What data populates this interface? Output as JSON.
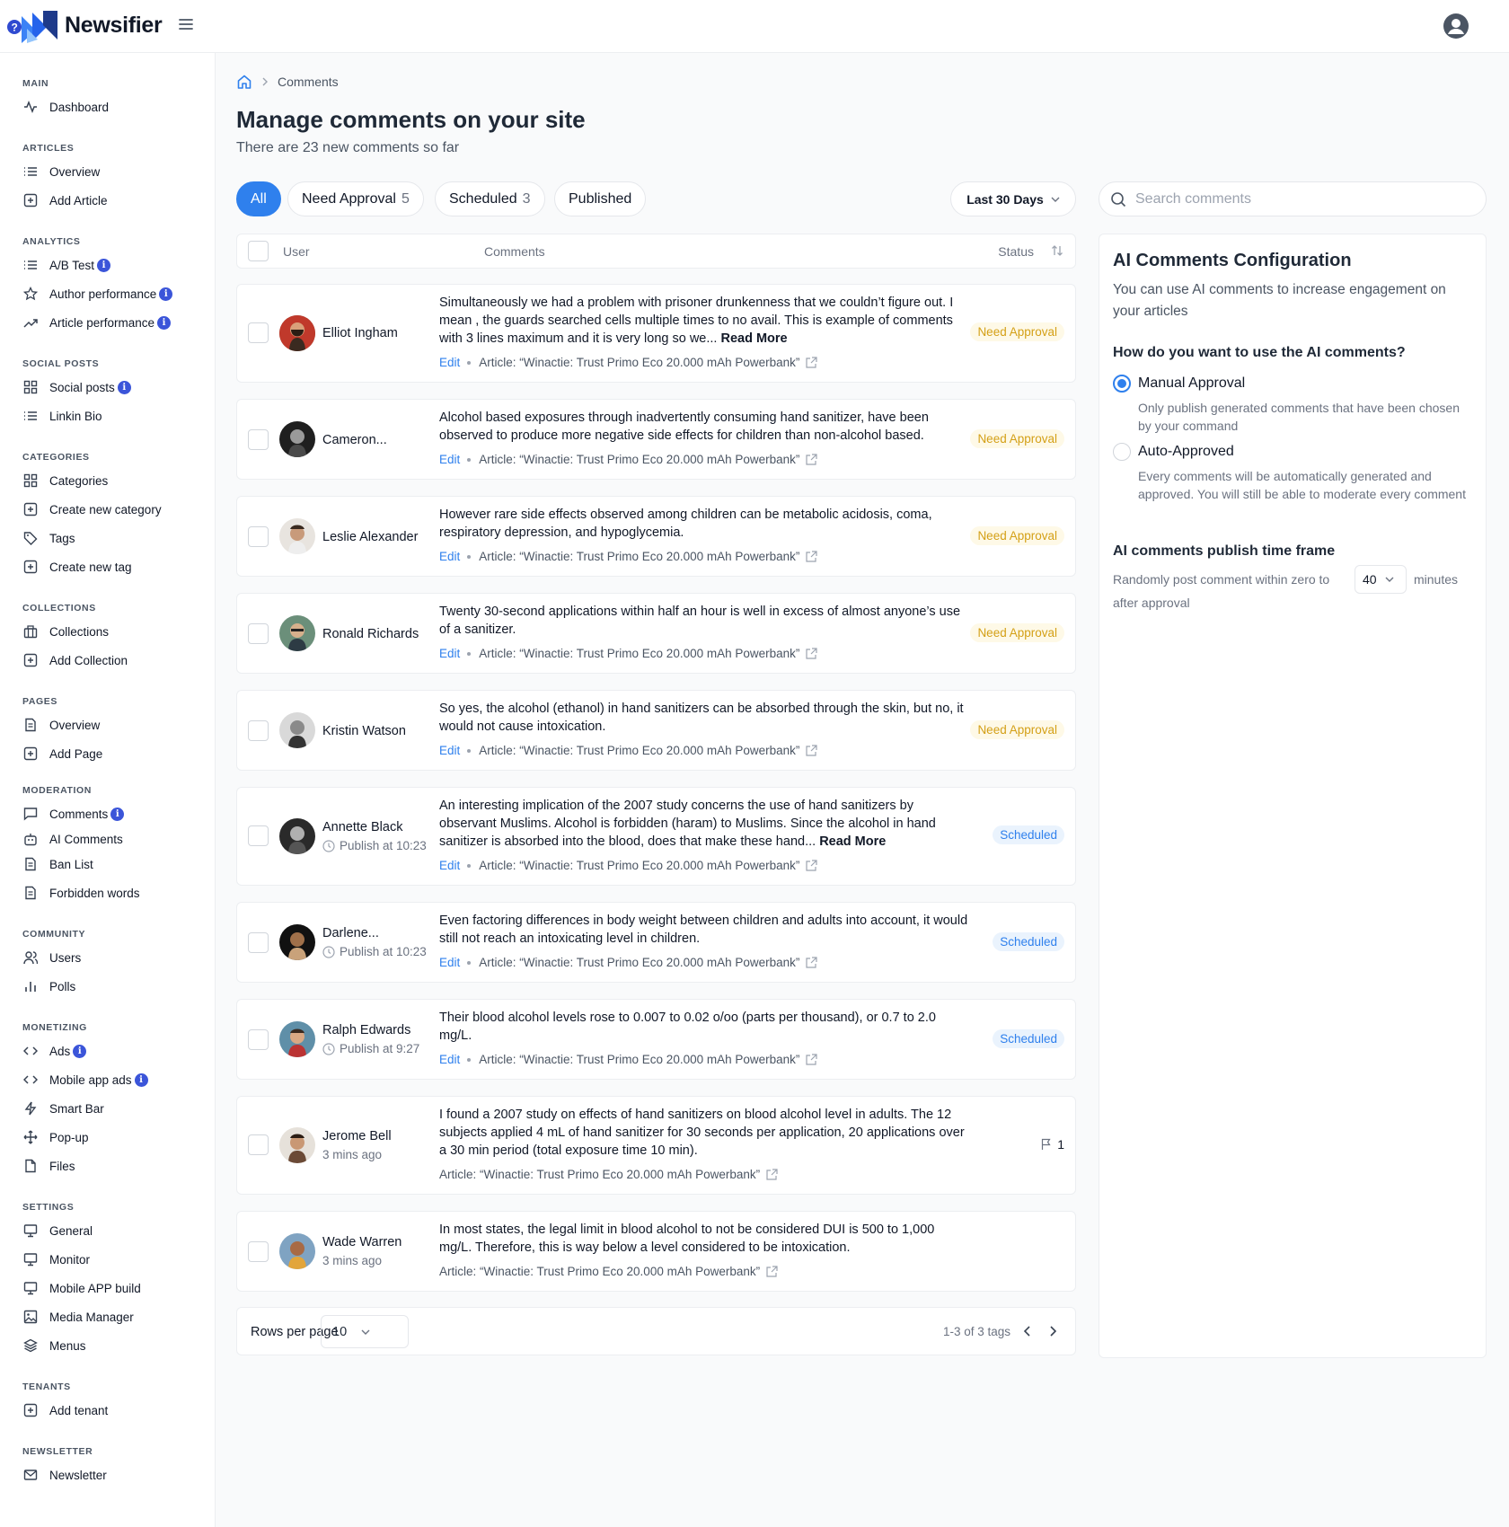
{
  "app": {
    "name": "Newsifier"
  },
  "breadcrumb": {
    "current": "Comments"
  },
  "page": {
    "title": "Manage comments on your site",
    "subtitle": "There are 23 new comments so far"
  },
  "tabs": [
    {
      "label": "All",
      "count": ""
    },
    {
      "label": "Need Approval",
      "count": "5"
    },
    {
      "label": "Scheduled",
      "count": "3"
    },
    {
      "label": "Published",
      "count": ""
    }
  ],
  "date_range": "Last 30 Days",
  "search": {
    "placeholder": "Search comments"
  },
  "table_header": {
    "user": "User",
    "comments": "Comments",
    "status": "Status"
  },
  "sidebar": {
    "main": "MAIN",
    "dashboard": "Dashboard",
    "articles": "ARTICLES",
    "overview": "Overview",
    "add_article": "Add Article",
    "analytics": "ANALYTICS",
    "ab_test": "A/B Test",
    "author_perf": "Author performance",
    "article_perf": "Article performance",
    "social": "SOCIAL POSTS",
    "social_posts": "Social posts",
    "linkin_bio": "Linkin Bio",
    "categories_h": "CATEGORIES",
    "categories": "Categories",
    "create_category": "Create new category",
    "tags": "Tags",
    "create_tag": "Create new tag",
    "collections_h": "COLLECTIONS",
    "collections": "Collections",
    "add_collection": "Add Collection",
    "pages_h": "PAGES",
    "pages_overview": "Overview",
    "add_page": "Add Page",
    "moderation_h": "MODERATION",
    "comments": "Comments",
    "ai_comments": "AI Comments",
    "ban_list": "Ban List",
    "forbidden_words": "Forbidden words",
    "community_h": "COMMUNITY",
    "users": "Users",
    "polls": "Polls",
    "monetizing_h": "MONETIZING",
    "ads": "Ads",
    "mobile_ads": "Mobile app ads",
    "smart_bar": "Smart Bar",
    "popup": "Pop-up",
    "files": "Files",
    "settings_h": "SETTINGS",
    "general": "General",
    "monitor": "Monitor",
    "mobile_build": "Mobile APP build",
    "media_manager": "Media Manager",
    "menus": "Menus",
    "tenants_h": "TENANTS",
    "add_tenant": "Add tenant",
    "newsletter_h": "NEWSLETTER",
    "newsletter": "Newsletter",
    "info_glyph": "i"
  },
  "labels": {
    "edit": "Edit",
    "read_more": "Read More",
    "article": "Article: “Winactie: Trust Primo Eco 20.000 mAh Powerbank”"
  },
  "comments": [
    {
      "user": "Elliot Ingham",
      "meta": "",
      "text": "Simultaneously we had a problem with prisoner drunkenness that we couldn’t figure out. I mean , the guards searched cells multiple times to no avail. This is example of comments with 3 lines maximum and it is very long so we...",
      "status": "Need Approval"
    },
    {
      "user": "Cameron...",
      "meta": "",
      "text": "Alcohol based exposures through inadvertently consuming hand sanitizer, have been observed to produce more negative side effects for children than non-alcohol based.",
      "status": "Need Approval"
    },
    {
      "user": "Leslie Alexander",
      "meta": "",
      "text": "However rare side effects observed among children can be metabolic acidosis, coma, respiratory depression, and hypoglycemia.",
      "status": "Need Approval"
    },
    {
      "user": "Ronald Richards",
      "meta": "",
      "text": "Twenty 30-second applications within half an hour is well in excess of almost anyone’s use of a sanitizer.",
      "status": "Need Approval"
    },
    {
      "user": "Kristin Watson",
      "meta": "",
      "text": "So yes, the alcohol (ethanol) in hand sanitizers can be absorbed through the skin, but no, it would not cause intoxication.",
      "status": "Need Approval"
    },
    {
      "user": "Annette Black",
      "meta": "Publish at 10:23",
      "text": "An interesting implication of the 2007 study concerns the use of hand sanitizers by observant Muslims. Alcohol is forbidden (haram) to Muslims. Since the alcohol in hand sanitizer is absorbed into the blood, does that make these hand...",
      "status": "Scheduled"
    },
    {
      "user": "Darlene...",
      "meta": "Publish at 10:23",
      "text": "Even factoring differences in body weight between children and adults into account, it would still not reach an intoxicating level in children.",
      "status": "Scheduled"
    },
    {
      "user": "Ralph Edwards",
      "meta": "Publish at 9:27",
      "text": "Their blood alcohol levels rose to 0.007 to 0.02 o/oo (parts per thousand), or 0.7 to 2.0 mg/L.",
      "status": "Scheduled"
    },
    {
      "user": "Jerome Bell",
      "meta": "3 mins ago",
      "text": "I found a 2007 study on effects of hand sanitizers on blood alcohol level in adults. The 12 subjects applied 4 mL of hand sanitizer for 30 seconds per application, 20 applications over a 30 min period (total exposure time 10 min).",
      "flags": "1"
    },
    {
      "user": "Wade Warren",
      "meta": "3 mins ago",
      "text": "In most states, the legal limit in blood alcohol to not be considered DUI is 500 to 1,000 mg/L. Therefore, this is way below a level considered to be intoxication."
    }
  ],
  "pagination": {
    "rows_label": "Rows per page",
    "rows_value": "10",
    "range": "1-3 of 3 tags"
  },
  "ai_config": {
    "title": "AI Comments Configuration",
    "desc": "You can use AI comments to increase engagement on your articles",
    "question": "How do you want to use the AI comments?",
    "manual_label": "Manual Approval",
    "manual_desc": "Only publish generated comments that have been chosen by your command",
    "auto_label": "Auto-Approved",
    "auto_desc": "Every comments will be automatically generated and approved. You will still be able to moderate every comment",
    "timeframe_title": "AI comments publish time frame",
    "timeframe_prefix": "Randomly post comment within zero to",
    "timeframe_value": "40",
    "timeframe_suffix": "minutes",
    "timeframe_tail": "after approval"
  },
  "colors": {
    "accent": "#2f80ed",
    "need_approval": "#d4a017",
    "scheduled": "#2f80ed",
    "info_badge": "#3b55d9"
  }
}
